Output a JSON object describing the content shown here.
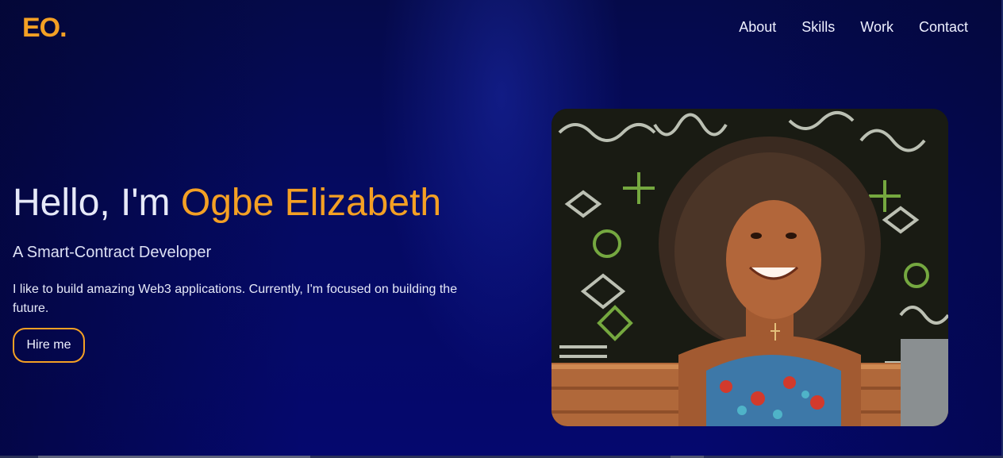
{
  "brand": {
    "logo_text": "EO.",
    "accent_color": "#f4a024"
  },
  "nav": {
    "items": [
      "About",
      "Skills",
      "Work",
      "Contact"
    ]
  },
  "hero": {
    "greeting": "Hello, I'm ",
    "name": "Ogbe Elizabeth",
    "subtitle": "A Smart-Contract Developer",
    "bio": "I like to build amazing Web3 applications. Currently, I'm focused on building the future.",
    "cta_label": "Hire me"
  },
  "photo": {
    "alt": "Portrait of Ogbe Elizabeth"
  },
  "theme": {
    "background": "#050a62",
    "text": "#e6e9f8"
  }
}
